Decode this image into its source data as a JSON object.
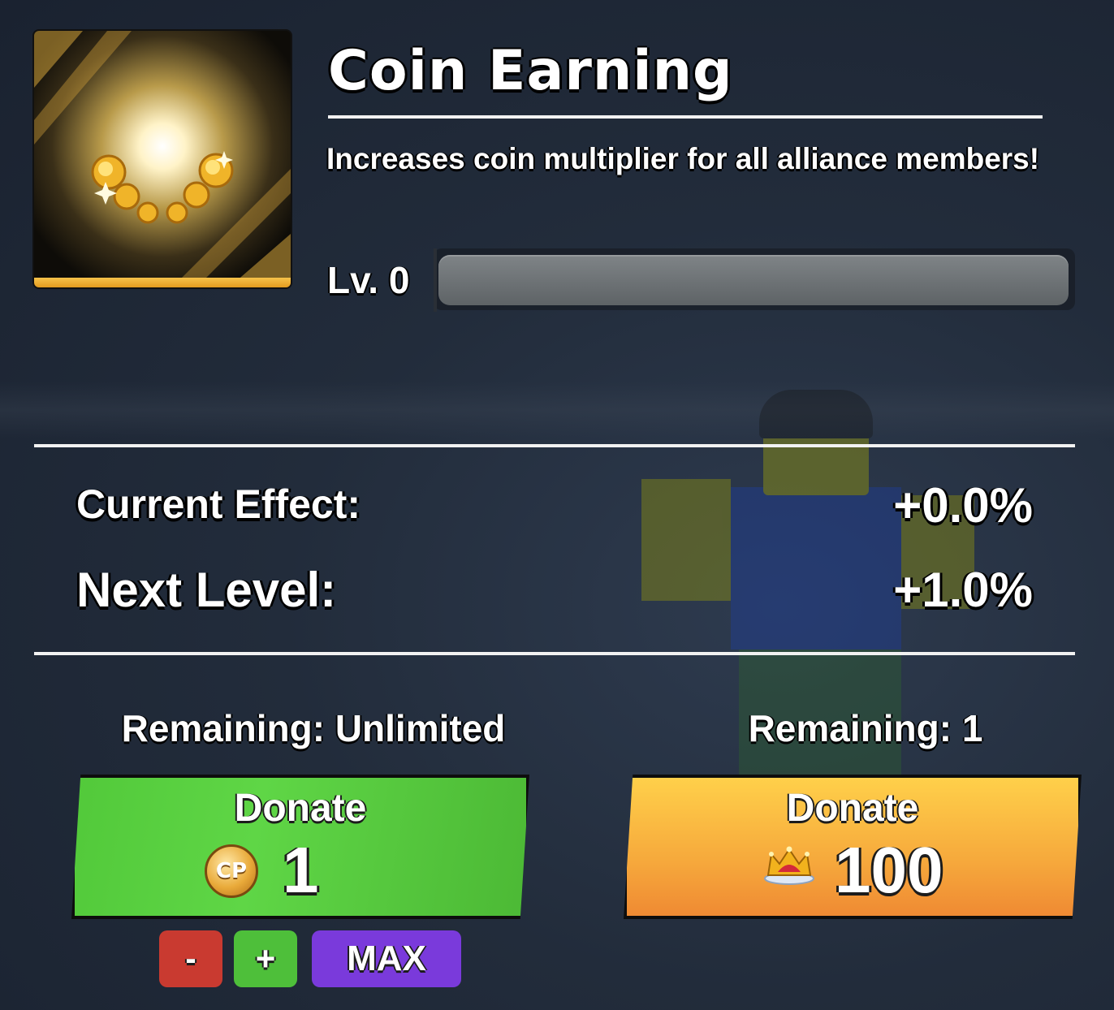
{
  "upgrade": {
    "title": "Coin Earning",
    "description": "Increases coin multiplier for all alliance members!",
    "level_label": "Lv. 0",
    "progress": 0.0
  },
  "stats": {
    "current_effect_label": "Current Effect:",
    "current_effect_value": "+0.0%",
    "next_level_label": "Next Level:",
    "next_level_value": "+1.0%"
  },
  "donate_left": {
    "remaining": "Remaining: Unlimited",
    "label": "Donate",
    "amount": "1",
    "currency_badge": "CP",
    "currency_icon": "cp-coin-icon",
    "color": "#52c93a"
  },
  "donate_right": {
    "remaining": "Remaining: 1",
    "label": "Donate",
    "amount": "100",
    "currency_icon": "crown-icon",
    "color": "#f6a93c"
  },
  "stepper": {
    "minus_label": "-",
    "plus_label": "+",
    "max_label": "MAX"
  },
  "colors": {
    "minus": "#c93a30",
    "plus": "#4ebf3a",
    "max": "#7a3adb"
  }
}
